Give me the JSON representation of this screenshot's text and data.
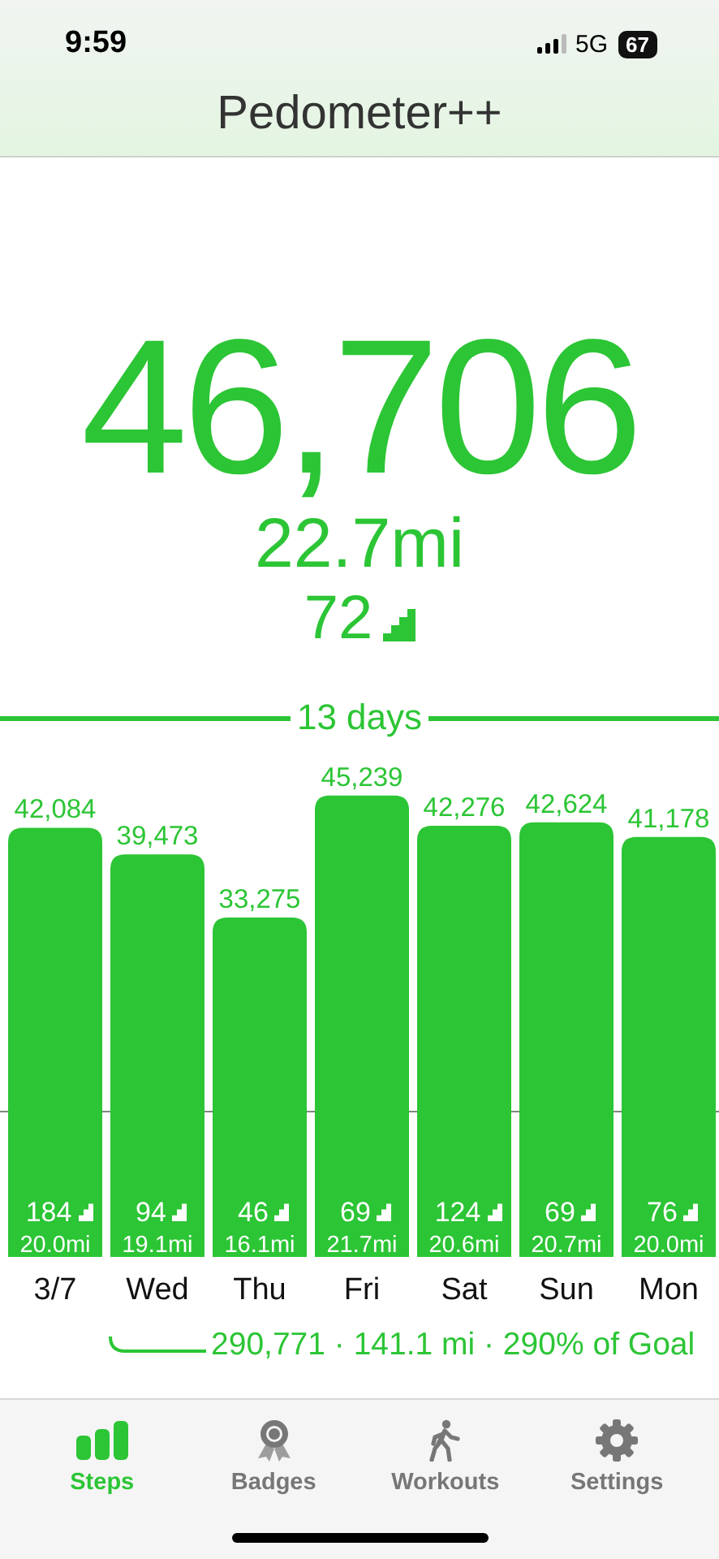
{
  "status_bar": {
    "time": "9:59",
    "network": "5G",
    "battery": "67"
  },
  "title": "Pedometer++",
  "today": {
    "steps": "46,706",
    "distance": "22.7mi",
    "floors": "72"
  },
  "range_label": "13 days",
  "chart_data": {
    "type": "bar",
    "categories": [
      "3/7",
      "Wed",
      "Thu",
      "Fri",
      "Sat",
      "Sun",
      "Mon"
    ],
    "values": [
      42084,
      39473,
      33275,
      45239,
      42276,
      42624,
      41178
    ],
    "value_labels": [
      "42,084",
      "39,473",
      "33,275",
      "45,239",
      "42,276",
      "42,624",
      "41,178"
    ]
  },
  "bar_details": [
    {
      "floors": "184",
      "miles": "20.0mi"
    },
    {
      "floors": "94",
      "miles": "19.1mi"
    },
    {
      "floors": "46",
      "miles": "16.1mi"
    },
    {
      "floors": "69",
      "miles": "21.7mi"
    },
    {
      "floors": "124",
      "miles": "20.6mi"
    },
    {
      "floors": "69",
      "miles": "20.7mi"
    },
    {
      "floors": "76",
      "miles": "20.0mi"
    }
  ],
  "summary": "290,771 · 141.1 mi · 290% of Goal",
  "tabs": [
    {
      "label": "Steps",
      "kind": "steps",
      "selected": true
    },
    {
      "label": "Badges",
      "kind": "badges",
      "selected": false
    },
    {
      "label": "Workouts",
      "kind": "workouts",
      "selected": false
    },
    {
      "label": "Settings",
      "kind": "settings",
      "selected": false
    }
  ]
}
